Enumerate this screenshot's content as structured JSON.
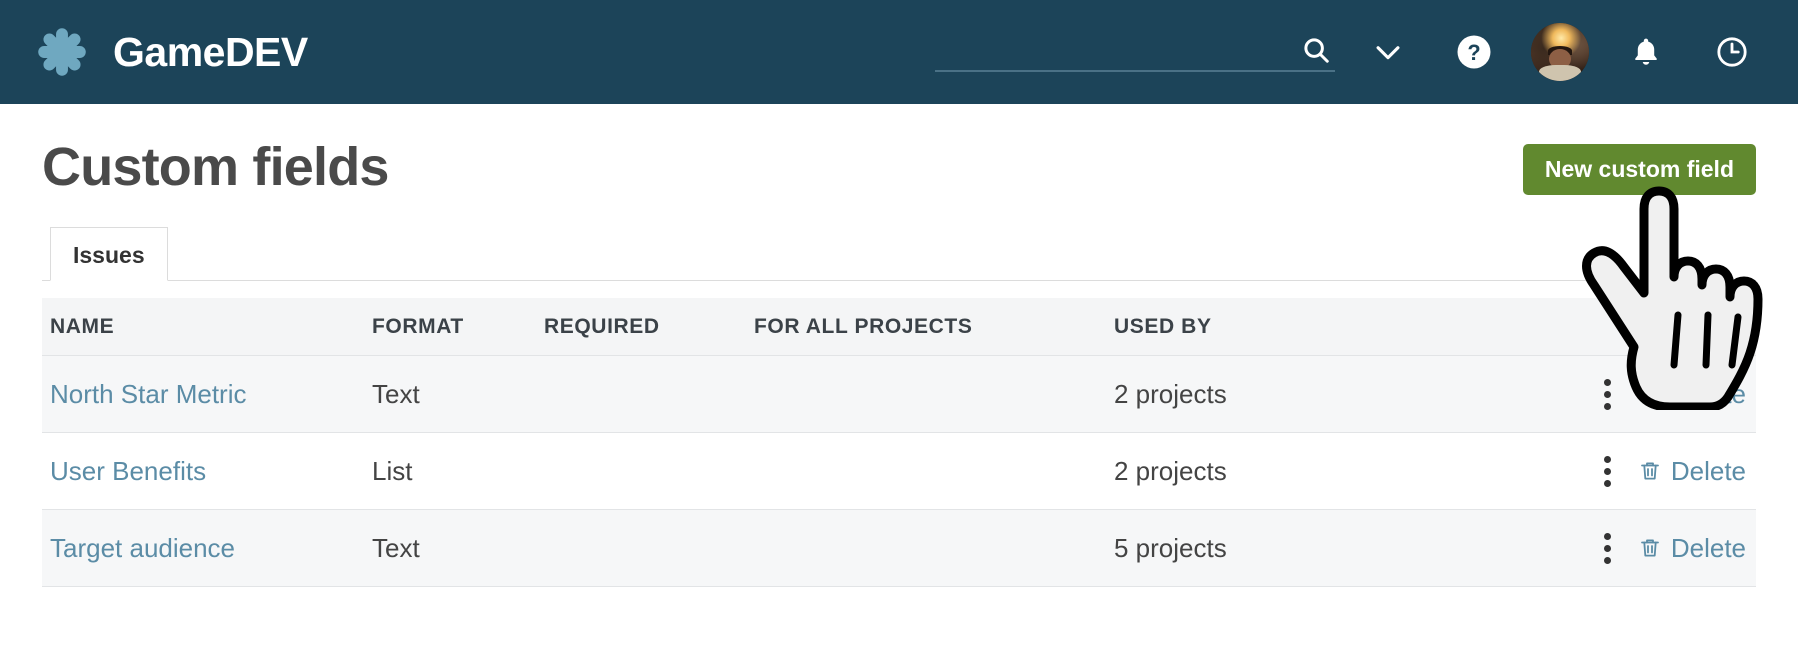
{
  "topbar": {
    "brand_name": "GameDEV",
    "logo_icon": "asterisk-flower-icon",
    "search_value": "",
    "search_placeholder": "",
    "icons": [
      {
        "name": "search-icon"
      },
      {
        "name": "chevron-down-icon"
      },
      {
        "name": "help-circle-icon"
      },
      {
        "name": "avatar"
      },
      {
        "name": "bell-icon"
      },
      {
        "name": "clock-icon"
      }
    ],
    "colors": {
      "background": "#1c4459",
      "logo": "#6fa8c0",
      "underline": "#4a7186"
    }
  },
  "page": {
    "title": "Custom fields",
    "new_field_button": "New custom field",
    "button_color": "#61892f"
  },
  "tabs": [
    {
      "label": "Issues",
      "active": true
    }
  ],
  "table": {
    "headers": [
      "NAME",
      "FORMAT",
      "REQUIRED",
      "FOR ALL PROJECTS",
      "USED BY",
      ""
    ],
    "rows": [
      {
        "name": "North Star Metric",
        "format": "Text",
        "required": "",
        "for_all_projects": "",
        "used_by": "2 projects",
        "menu_icon": "kebab-menu-icon",
        "delete_icon": "trash-icon",
        "delete_label": "Delete"
      },
      {
        "name": "User Benefits",
        "format": "List",
        "required": "",
        "for_all_projects": "",
        "used_by": "2 projects",
        "menu_icon": "kebab-menu-icon",
        "delete_icon": "trash-icon",
        "delete_label": "Delete"
      },
      {
        "name": "Target audience",
        "format": "Text",
        "required": "",
        "for_all_projects": "",
        "used_by": "5 projects",
        "menu_icon": "kebab-menu-icon",
        "delete_icon": "trash-icon",
        "delete_label": "Delete"
      }
    ],
    "link_color": "#5b8ca6"
  },
  "cursor": {
    "icon": "pointing-hand-cursor"
  }
}
